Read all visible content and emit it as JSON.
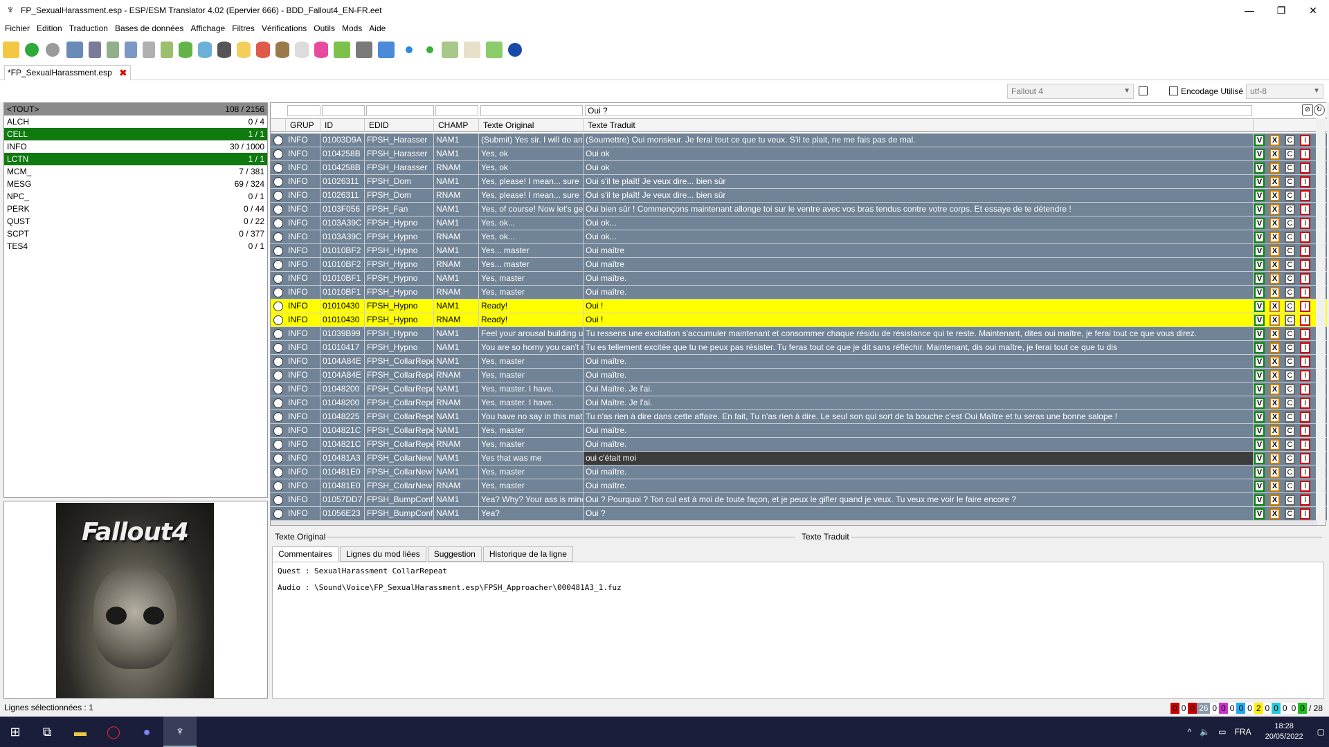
{
  "window": {
    "title": "FP_SexualHarassment.esp - ESP/ESM Translator 4.02 (Epervier 666) - BDD_Fallout4_EN-FR.eet",
    "minimize": "—",
    "maximize": "❐",
    "close": "✕"
  },
  "menu": [
    "Fichier",
    "Edition",
    "Traduction",
    "Bases de données",
    "Affichage",
    "Filtres",
    "Vérifications",
    "Outils",
    "Mods",
    "Aide"
  ],
  "file_tab": {
    "label": "*FP_SexualHarassment.esp",
    "close": "✖"
  },
  "options": {
    "game_combo": "Fallout 4",
    "encoding_label": "Encodage Utilisé",
    "encoding_combo": "utf-8"
  },
  "categories": [
    {
      "name": "<TOUT>",
      "count": "108 / 2156",
      "state": "all"
    },
    {
      "name": "ALCH",
      "count": "0 / 4",
      "state": ""
    },
    {
      "name": "CELL",
      "count": "1 / 1",
      "state": "done"
    },
    {
      "name": "INFO",
      "count": "30 / 1000",
      "state": ""
    },
    {
      "name": "LCTN",
      "count": "1 / 1",
      "state": "done"
    },
    {
      "name": "MCM_",
      "count": "7 / 381",
      "state": ""
    },
    {
      "name": "MESG",
      "count": "69 / 324",
      "state": ""
    },
    {
      "name": "NPC_",
      "count": "0 / 1",
      "state": ""
    },
    {
      "name": "PERK",
      "count": "0 / 44",
      "state": ""
    },
    {
      "name": "QUST",
      "count": "0 / 22",
      "state": ""
    },
    {
      "name": "SCPT",
      "count": "0 / 377",
      "state": ""
    },
    {
      "name": "TES4",
      "count": "0 / 1",
      "state": ""
    }
  ],
  "poster": {
    "logo": "Fallout4"
  },
  "filter": {
    "translated": "Oui ?"
  },
  "columns": [
    "GRUP",
    "ID",
    "EDID",
    "CHAMP",
    "Texte Original",
    "Texte Traduit"
  ],
  "action_buttons": [
    "V",
    "X",
    "C",
    "I"
  ],
  "rows": [
    {
      "grup": "INFO",
      "id": "01003D9A",
      "edid": "FPSH_Harasser",
      "champ": "NAM1",
      "orig": "(Submit) Yes sir. I will do anything you want. Please don't hurt me.",
      "trad": "(Soumettre) Oui monsieur. Je ferai tout ce que tu veux. S'il te plait, ne me fais pas de mal.",
      "hl": false,
      "dark": false
    },
    {
      "grup": "INFO",
      "id": "0104258B",
      "edid": "FPSH_Harasser",
      "champ": "NAM1",
      "orig": "Yes, ok",
      "trad": "Oui ok",
      "hl": false,
      "dark": false
    },
    {
      "grup": "INFO",
      "id": "0104258B",
      "edid": "FPSH_Harasser",
      "champ": "RNAM",
      "orig": "Yes, ok",
      "trad": "Oui ok",
      "hl": false,
      "dark": false
    },
    {
      "grup": "INFO",
      "id": "01026311",
      "edid": "FPSH_Dom",
      "champ": "NAM1",
      "orig": "Yes, please! I mean... sure",
      "trad": "Oui s'il te plaît! Je veux dire... bien sûr",
      "hl": false,
      "dark": false
    },
    {
      "grup": "INFO",
      "id": "01026311",
      "edid": "FPSH_Dom",
      "champ": "RNAM",
      "orig": "Yes, please! I mean... sure",
      "trad": "Oui s'il te plaît! Je veux dire... bien sûr",
      "hl": false,
      "dark": false
    },
    {
      "grup": "INFO",
      "id": "0103F056",
      "edid": "FPSH_Fan",
      "champ": "NAM1",
      "orig": "Yes, of course! Now let's get started.",
      "trad": "Oui bien sûr ! Commençons maintenant allonge toi sur le ventre avec vos bras tendus contre votre corps. Et essaye de te détendre !",
      "hl": false,
      "dark": false
    },
    {
      "grup": "INFO",
      "id": "0103A39C",
      "edid": "FPSH_Hypno",
      "champ": "NAM1",
      "orig": "Yes, ok...",
      "trad": "Oui ok...",
      "hl": false,
      "dark": false
    },
    {
      "grup": "INFO",
      "id": "0103A39C",
      "edid": "FPSH_Hypno",
      "champ": "RNAM",
      "orig": "Yes, ok...",
      "trad": "Oui ok...",
      "hl": false,
      "dark": false
    },
    {
      "grup": "INFO",
      "id": "01010BF2",
      "edid": "FPSH_Hypno",
      "champ": "NAM1",
      "orig": "Yes... master",
      "trad": "Oui maître",
      "hl": false,
      "dark": false
    },
    {
      "grup": "INFO",
      "id": "01010BF2",
      "edid": "FPSH_Hypno",
      "champ": "RNAM",
      "orig": "Yes... master",
      "trad": "Oui maître",
      "hl": false,
      "dark": false
    },
    {
      "grup": "INFO",
      "id": "01010BF1",
      "edid": "FPSH_Hypno",
      "champ": "NAM1",
      "orig": "Yes, master",
      "trad": "Oui maître.",
      "hl": false,
      "dark": false
    },
    {
      "grup": "INFO",
      "id": "01010BF1",
      "edid": "FPSH_Hypno",
      "champ": "RNAM",
      "orig": "Yes, master",
      "trad": "Oui maître.",
      "hl": false,
      "dark": false
    },
    {
      "grup": "INFO",
      "id": "01010430",
      "edid": "FPSH_Hypno",
      "champ": "NAM1",
      "orig": "Ready!",
      "trad": "Oui !",
      "hl": true,
      "dark": false
    },
    {
      "grup": "INFO",
      "id": "01010430",
      "edid": "FPSH_Hypno",
      "champ": "RNAM",
      "orig": "Ready!",
      "trad": "Oui !",
      "hl": true,
      "dark": false
    },
    {
      "grup": "INFO",
      "id": "01039B99",
      "edid": "FPSH_Hypno",
      "champ": "NAM1",
      "orig": "Feel your arousal building up",
      "trad": "Tu ressens une excitation s'accumuler maintenant et consommer chaque résidu de résistance qui te reste. Maintenant, dites oui maître, je ferai tout ce que vous direz.",
      "hl": false,
      "dark": false
    },
    {
      "grup": "INFO",
      "id": "01010417",
      "edid": "FPSH_Hypno",
      "champ": "NAM1",
      "orig": "You are so horny you can't resist",
      "trad": "Tu es tellement excitée que tu ne peux pas résister. Tu feras tout ce que je dit sans réfléchir. Maintenant, dis oui maître, je ferai tout ce que tu dis",
      "hl": false,
      "dark": false
    },
    {
      "grup": "INFO",
      "id": "0104A84E",
      "edid": "FPSH_CollarRepeat",
      "champ": "NAM1",
      "orig": "Yes, master",
      "trad": "Oui maître.",
      "hl": false,
      "dark": false
    },
    {
      "grup": "INFO",
      "id": "0104A84E",
      "edid": "FPSH_CollarRepeat",
      "champ": "RNAM",
      "orig": "Yes, master",
      "trad": "Oui maître.",
      "hl": false,
      "dark": false
    },
    {
      "grup": "INFO",
      "id": "01048200",
      "edid": "FPSH_CollarRepeat",
      "champ": "NAM1",
      "orig": "Yes, master. I have.",
      "trad": "Oui Maître. Je l'ai.",
      "hl": false,
      "dark": false
    },
    {
      "grup": "INFO",
      "id": "01048200",
      "edid": "FPSH_CollarRepeat",
      "champ": "RNAM",
      "orig": "Yes, master. I have.",
      "trad": "Oui Maître. Je l'ai.",
      "hl": false,
      "dark": false
    },
    {
      "grup": "INFO",
      "id": "01048225",
      "edid": "FPSH_CollarRepeat",
      "champ": "NAM1",
      "orig": "You have no say in this matter",
      "trad": "Tu n'as rien à dire dans cette affaire. En fait, Tu n'as rien à dire. Le seul son qui sort de ta bouche c'est Oui Maître et tu seras une bonne salope !",
      "hl": false,
      "dark": false
    },
    {
      "grup": "INFO",
      "id": "0104821C",
      "edid": "FPSH_CollarRepeat",
      "champ": "NAM1",
      "orig": "Yes, master",
      "trad": "Oui maître.",
      "hl": false,
      "dark": false
    },
    {
      "grup": "INFO",
      "id": "0104821C",
      "edid": "FPSH_CollarRepeat",
      "champ": "RNAM",
      "orig": "Yes, master",
      "trad": "Oui maître.",
      "hl": false,
      "dark": false
    },
    {
      "grup": "INFO",
      "id": "010481A3",
      "edid": "FPSH_CollarNew",
      "champ": "NAM1",
      "orig": "Yes that was me",
      "trad": "oui c'était moi",
      "hl": false,
      "dark": true
    },
    {
      "grup": "INFO",
      "id": "010481E0",
      "edid": "FPSH_CollarNew",
      "champ": "NAM1",
      "orig": "Yes, master",
      "trad": "Oui maître.",
      "hl": false,
      "dark": false
    },
    {
      "grup": "INFO",
      "id": "010481E0",
      "edid": "FPSH_CollarNew",
      "champ": "RNAM",
      "orig": "Yes, master",
      "trad": "Oui maître.",
      "hl": false,
      "dark": false
    },
    {
      "grup": "INFO",
      "id": "01057DD7",
      "edid": "FPSH_BumpConfront",
      "champ": "NAM1",
      "orig": "Yea? Why? Your ass is mine",
      "trad": "Oui ? Pourquoi ? Ton cul est à moi de toute façon, et je peux le gifler quand je veux. Tu veux me voir le faire encore ?",
      "hl": false,
      "dark": false
    },
    {
      "grup": "INFO",
      "id": "01056E23",
      "edid": "FPSH_BumpConfront",
      "champ": "NAM1",
      "orig": "Yea?",
      "trad": "Oui ?",
      "hl": false,
      "dark": false
    }
  ],
  "sections": {
    "original": "Texte Original",
    "translated": "Texte Traduit"
  },
  "bottom_tabs": [
    "Commentaires",
    "Lignes du mod liées",
    "Suggestion",
    "Historique de la ligne"
  ],
  "comment_lines": [
    "Quest : SexualHarassment CollarRepeat",
    "Audio : \\Sound\\Voice\\FP_SexualHarassment.esp\\FPSH_Approacher\\000481A3_1.fuz"
  ],
  "status": {
    "selected": "Lignes sélectionnées : 1",
    "counters": [
      {
        "v": "0",
        "bg": "#cc0000",
        "fg": "#000"
      },
      {
        "v": "0",
        "bg": "#ffffff",
        "fg": "#000"
      },
      {
        "v": "0",
        "bg": "#cc0000",
        "fg": "#000"
      },
      {
        "v": "26",
        "bg": "#8899aa",
        "fg": "#fff"
      },
      {
        "v": "0",
        "bg": "#ffffff",
        "fg": "#000"
      },
      {
        "v": "0",
        "bg": "#cc33cc",
        "fg": "#000"
      },
      {
        "v": "0",
        "bg": "#ffffff",
        "fg": "#000"
      },
      {
        "v": "0",
        "bg": "#22aaee",
        "fg": "#000"
      },
      {
        "v": "0",
        "bg": "#ffffff",
        "fg": "#000"
      },
      {
        "v": "2",
        "bg": "#ffee00",
        "fg": "#000"
      },
      {
        "v": "0",
        "bg": "#ffffff",
        "fg": "#000"
      },
      {
        "v": "0",
        "bg": "#22ccdd",
        "fg": "#000"
      },
      {
        "v": "0",
        "bg": "#ffffff",
        "fg": "#000"
      },
      {
        "v": "0",
        "bg": "#ffffff",
        "fg": "#000"
      },
      {
        "v": "0",
        "bg": "#22bb22",
        "fg": "#000"
      }
    ],
    "total": "/ 28"
  },
  "taskbar": {
    "language": "FRA",
    "time": "18:28",
    "date": "20/05/2022"
  },
  "colors": {
    "row": "#718396",
    "highlight": "#ffff00",
    "done": "#0f7a0f",
    "selected_cell": "#3c3c3c"
  }
}
